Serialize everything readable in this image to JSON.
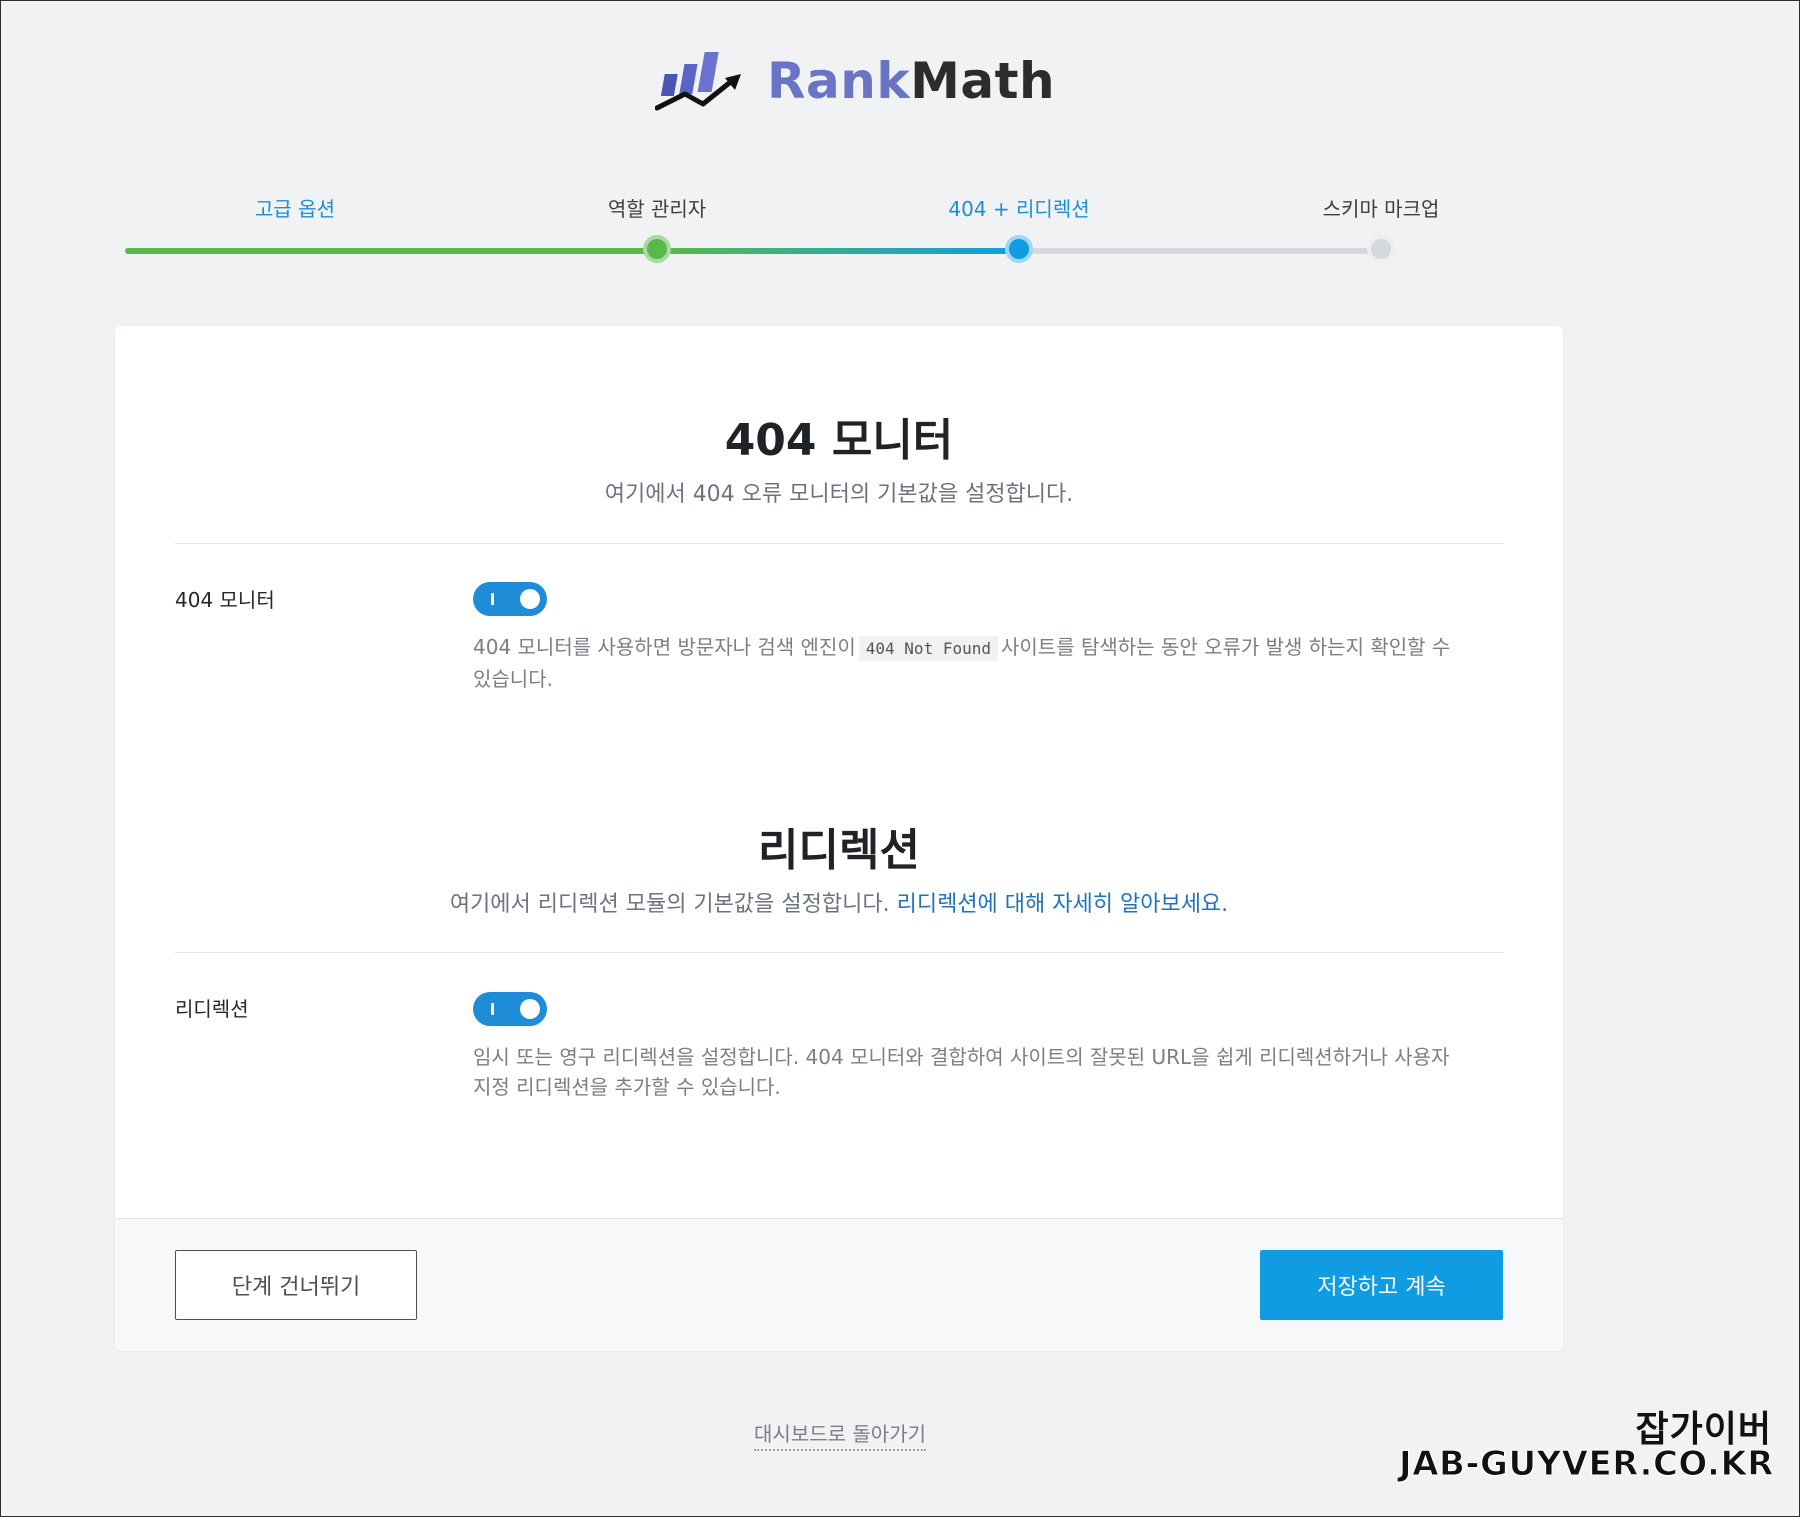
{
  "logo": {
    "text_rank": "Rank",
    "text_math": "Math"
  },
  "steps": [
    {
      "label": "고급 옵션",
      "state": "done"
    },
    {
      "label": "역할 관리자",
      "state": "done"
    },
    {
      "label": "404 + 리디렉션",
      "state": "current"
    },
    {
      "label": "스키마 마크업",
      "state": "todo"
    }
  ],
  "colors": {
    "done": "#59b94b",
    "current": "#109ce3",
    "todo": "#cfd3d8",
    "link": "#1e73be"
  },
  "monitor": {
    "title": "404 모니터",
    "desc": "여기에서 404 오류 모니터의 기본값을 설정합니다.",
    "field_label": "404 모니터",
    "toggle_on": true,
    "help_before": "404 모니터를 사용하면 방문자나 검색 엔진이",
    "help_code": "404 Not Found",
    "help_after": "사이트를 탐색하는 동안 오류가 발생 하는지 확인할 수 있습니다."
  },
  "redirect": {
    "title": "리디렉션",
    "desc": "여기에서 리디렉션 모듈의 기본값을 설정합니다.",
    "desc_link": "리디렉션에 대해 자세히 알아보세요.",
    "field_label": "리디렉션",
    "toggle_on": true,
    "help": "임시 또는 영구 리디렉션을 설정합니다. 404 모니터와 결합하여 사이트의 잘못된 URL을 쉽게 리디렉션하거나 사용자 지정 리디렉션을 추가할 수 있습니다."
  },
  "footer": {
    "skip_label": "단계 건너뛰기",
    "save_label": "저장하고 계속"
  },
  "back_link": "대시보드로 돌아가기",
  "watermark": {
    "line1": "잡가이버",
    "line2": "JAB-GUYVER.CO.KR"
  }
}
